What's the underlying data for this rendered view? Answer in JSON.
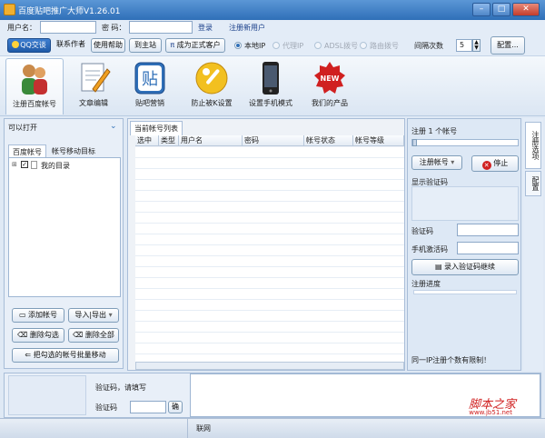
{
  "window": {
    "title": "百度贴吧推广大师V1.26.01"
  },
  "login": {
    "username_label": "用户名：",
    "password_label": "密  码：",
    "login_label": "登录",
    "register_label": "注册新用户"
  },
  "toolbar": {
    "qq_label": "QQ交谈",
    "contact_label": "联系作者",
    "help_label": "使用帮助",
    "site_label": "到主站",
    "upgrade_label": "成为正式客户",
    "radios": [
      {
        "label": "本地IP",
        "selected": true
      },
      {
        "label": "代理IP",
        "selected": false
      },
      {
        "label": "ADSL拨号",
        "selected": false
      },
      {
        "label": "路由拨号",
        "selected": false
      }
    ],
    "interval_label": "间隔次数",
    "interval_value": "5",
    "config_label": "配置..."
  },
  "ribbon": {
    "items": [
      {
        "label": "注册百度帐号",
        "icon": "users-icon"
      },
      {
        "label": "文章编辑",
        "icon": "edit-icon"
      },
      {
        "label": "贴吧营销",
        "icon": "tieba-icon"
      },
      {
        "label": "防止被K设置",
        "icon": "wrench-icon"
      },
      {
        "label": "设置手机模式",
        "icon": "phone-icon"
      },
      {
        "label": "我们的产品",
        "icon": "new-badge-icon"
      }
    ]
  },
  "left": {
    "header": "可以打开",
    "tabs": [
      "百度帐号",
      "帐号移动目标"
    ],
    "tree_item": "我的目录",
    "buttons": {
      "add": "添加帐号",
      "import_export": "导入|导出",
      "delete_checked": "删除勾选",
      "delete_all": "删除全部",
      "batch_move": "把勾选的帐号批量移动"
    }
  },
  "grid": {
    "tab": "当前帐号列表",
    "columns": [
      "选中",
      "类型",
      "用户名",
      "密码",
      "帐号状态",
      "帐号等级"
    ]
  },
  "right": {
    "register_count": "注册 1 个帐号",
    "register_btn": "注册帐号",
    "stop_btn": "停止",
    "captcha_display": "显示验证码",
    "captcha_label": "验证码",
    "phone_code_label": "手机激活码",
    "enter_captcha_btn": "录入验证码继续",
    "progress_label": "注册进度",
    "progress_value": 0,
    "limit_note": "同一IP注册个数有限制！",
    "side_tabs": [
      "注册选项",
      "配置"
    ]
  },
  "bottom": {
    "prompt": "验证码，请填写",
    "captcha_label": "验证码",
    "confirm_btn": "确"
  },
  "status": {
    "network": "联网"
  },
  "watermark": {
    "brand": "脚本之家",
    "url": "www.jb51.net"
  },
  "colors": {
    "titlebar": "#2f6fb8",
    "accent": "#2f6fb8",
    "watermark": "#d02020"
  }
}
